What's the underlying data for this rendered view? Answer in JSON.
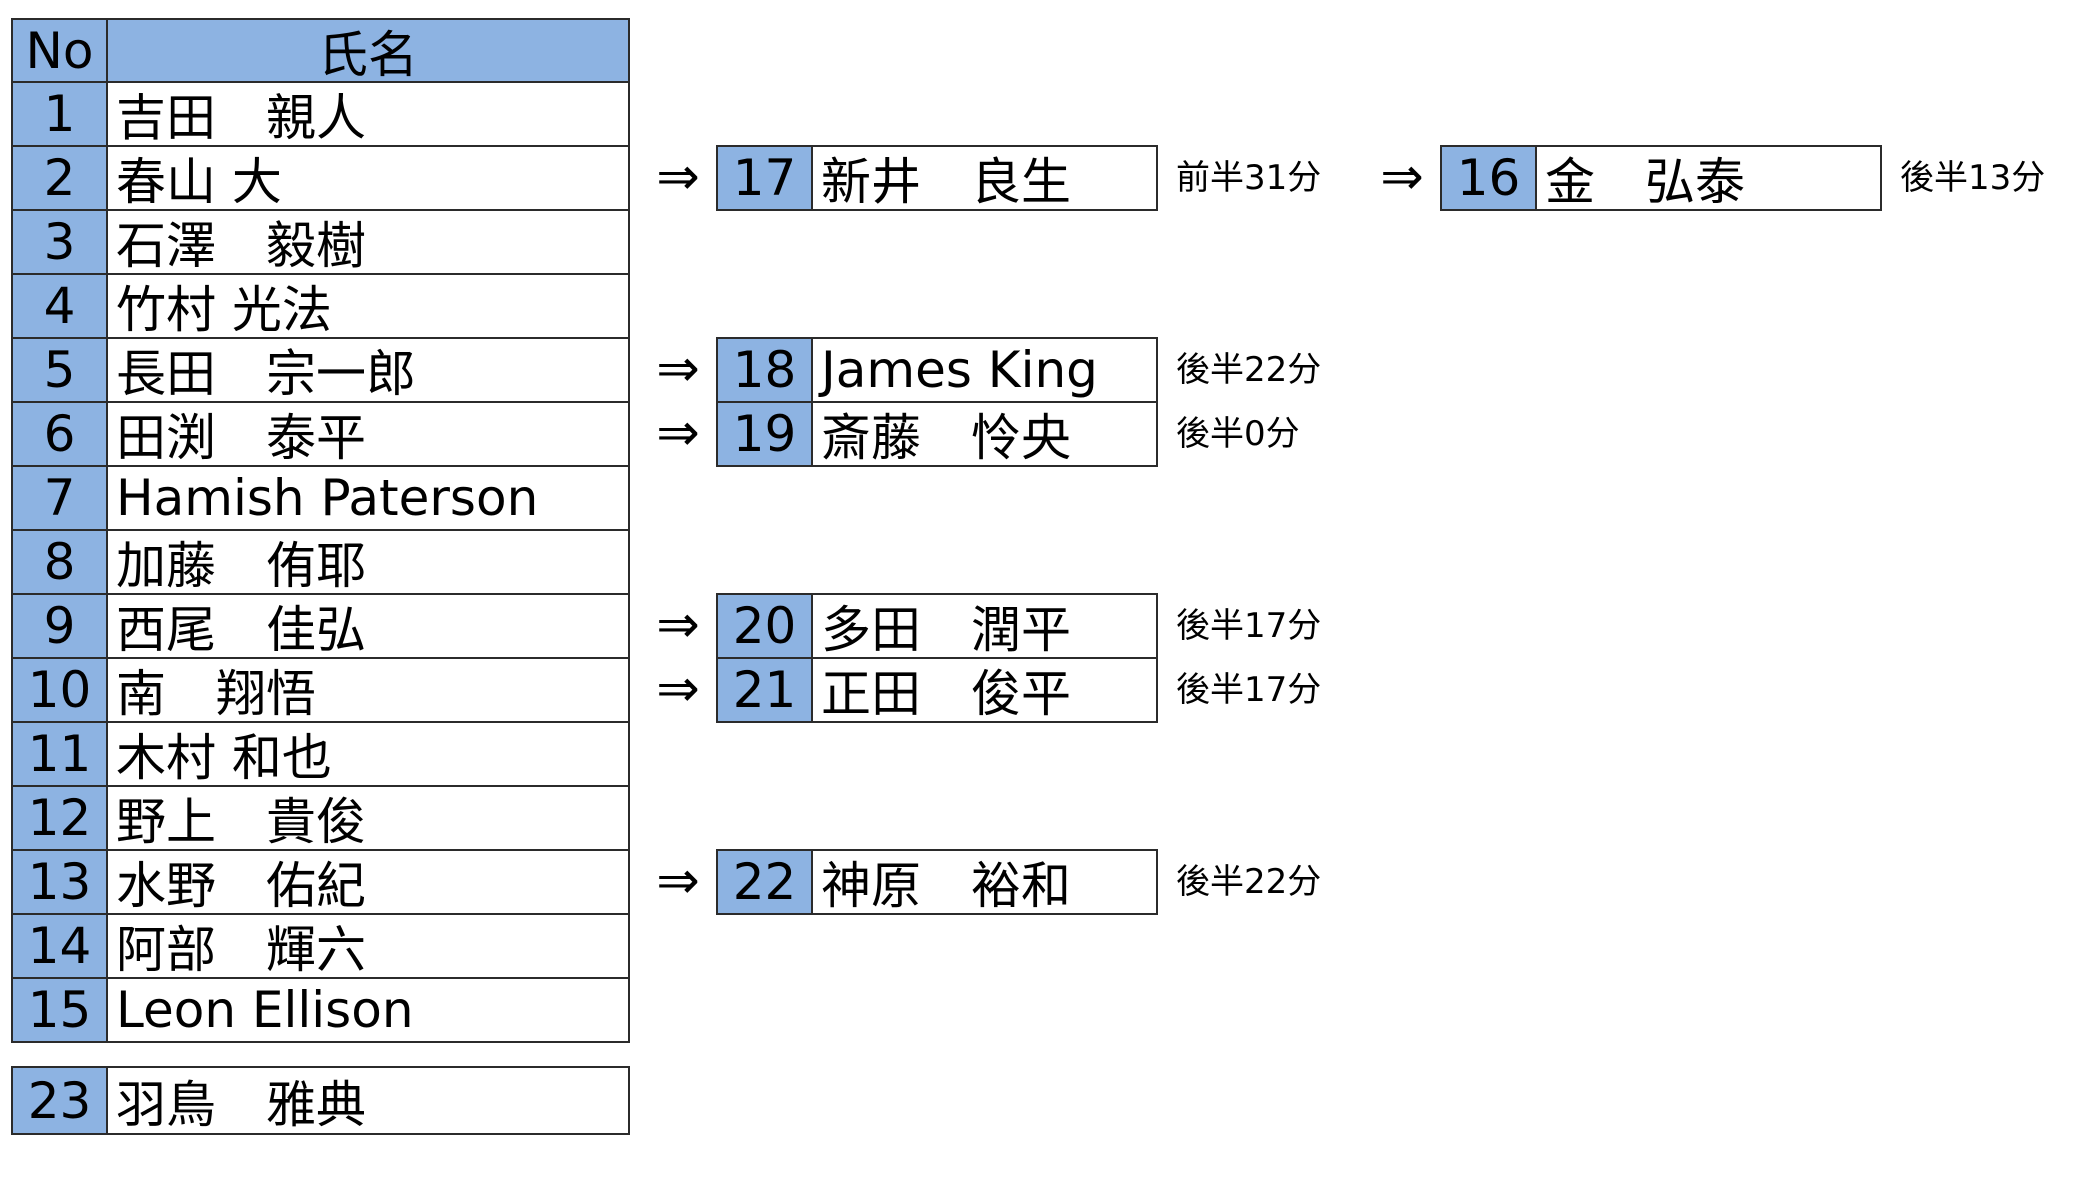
{
  "header": {
    "no": "No",
    "name": "氏名"
  },
  "starters": [
    {
      "no": "1",
      "name": "吉田　親人"
    },
    {
      "no": "2",
      "name": "春山 大"
    },
    {
      "no": "3",
      "name": "石澤　毅樹"
    },
    {
      "no": "4",
      "name": "竹村 光法"
    },
    {
      "no": "5",
      "name": "長田　宗一郎"
    },
    {
      "no": "6",
      "name": "田渕　泰平"
    },
    {
      "no": "7",
      "name": "Hamish Paterson"
    },
    {
      "no": "8",
      "name": "加藤　侑耶"
    },
    {
      "no": "9",
      "name": "西尾　佳弘"
    },
    {
      "no": "10",
      "name": "南　翔悟"
    },
    {
      "no": "11",
      "name": "木村 和也"
    },
    {
      "no": "12",
      "name": "野上　貴俊"
    },
    {
      "no": "13",
      "name": "水野　佑紀"
    },
    {
      "no": "14",
      "name": "阿部　輝六"
    },
    {
      "no": "15",
      "name": "Leon Ellison"
    }
  ],
  "reserve": {
    "no": "23",
    "name": "羽鳥　雅典"
  },
  "arrow": "⇒",
  "substitutions": [
    {
      "replaces_row": 2,
      "no": "17",
      "name": "新井　良生",
      "time": "前半31分"
    },
    {
      "replaces_row": 5,
      "no": "18",
      "name": "James King",
      "time": "後半22分"
    },
    {
      "replaces_row": 6,
      "no": "19",
      "name": "斎藤　怜央",
      "time": "後半0分"
    },
    {
      "replaces_row": 9,
      "no": "20",
      "name": "多田　潤平",
      "time": "後半17分"
    },
    {
      "replaces_row": 10,
      "no": "21",
      "name": "正田　俊平",
      "time": "後半17分"
    },
    {
      "replaces_row": 13,
      "no": "22",
      "name": "神原　裕和",
      "time": "後半22分"
    }
  ],
  "second_substitutions": [
    {
      "replaces_row": 2,
      "no": "16",
      "name": "金　弘泰",
      "time": "後半13分"
    }
  ],
  "colors": {
    "header_fill": "#8db3e2",
    "number_fill": "#8db3e2",
    "border": "#2b2b2b"
  }
}
